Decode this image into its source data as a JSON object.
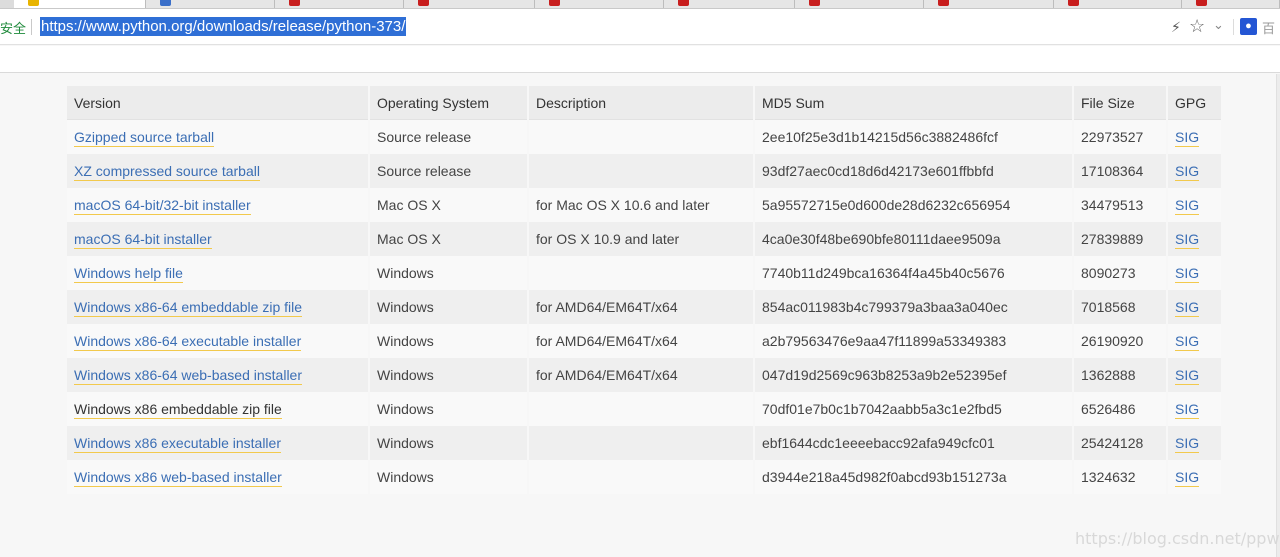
{
  "browser": {
    "security_label": "安全",
    "url": "https://www.python.org/downloads/release/python-373/",
    "extension_label": "百",
    "colors": {
      "selection": "#2f6fd6",
      "secure": "#1f8a3b",
      "tab_favicon": "#c81e1e"
    }
  },
  "table": {
    "headers": {
      "version": "Version",
      "os": "Operating System",
      "description": "Description",
      "md5": "MD5 Sum",
      "size": "File Size",
      "gpg": "GPG"
    },
    "rows": [
      {
        "version": "Gzipped source tarball",
        "os": "Source release",
        "description": "",
        "md5": "2ee10f25e3d1b14215d56c3882486fcf",
        "size": "22973527",
        "gpg": "SIG"
      },
      {
        "version": "XZ compressed source tarball",
        "os": "Source release",
        "description": "",
        "md5": "93df27aec0cd18d6d42173e601ffbbfd",
        "size": "17108364",
        "gpg": "SIG"
      },
      {
        "version": "macOS 64-bit/32-bit installer",
        "os": "Mac OS X",
        "description": "for Mac OS X 10.6 and later",
        "md5": "5a95572715e0d600de28d6232c656954",
        "size": "34479513",
        "gpg": "SIG"
      },
      {
        "version": "macOS 64-bit installer",
        "os": "Mac OS X",
        "description": "for OS X 10.9 and later",
        "md5": "4ca0e30f48be690bfe80111daee9509a",
        "size": "27839889",
        "gpg": "SIG"
      },
      {
        "version": "Windows help file",
        "os": "Windows",
        "description": "",
        "md5": "7740b11d249bca16364f4a45b40c5676",
        "size": "8090273",
        "gpg": "SIG"
      },
      {
        "version": "Windows x86-64 embeddable zip file",
        "os": "Windows",
        "description": "for AMD64/EM64T/x64",
        "md5": "854ac011983b4c799379a3baa3a040ec",
        "size": "7018568",
        "gpg": "SIG"
      },
      {
        "version": "Windows x86-64 executable installer",
        "os": "Windows",
        "description": "for AMD64/EM64T/x64",
        "md5": "a2b79563476e9aa47f11899a53349383",
        "size": "26190920",
        "gpg": "SIG"
      },
      {
        "version": "Windows x86-64 web-based installer",
        "os": "Windows",
        "description": "for AMD64/EM64T/x64",
        "md5": "047d19d2569c963b8253a9b2e52395ef",
        "size": "1362888",
        "gpg": "SIG"
      },
      {
        "version": "Windows x86 embeddable zip file",
        "os": "Windows",
        "description": "",
        "md5": "70df01e7b0c1b7042aabb5a3c1e2fbd5",
        "size": "6526486",
        "gpg": "SIG"
      },
      {
        "version": "Windows x86 executable installer",
        "os": "Windows",
        "description": "",
        "md5": "ebf1644cdc1eeeebacc92afa949cfc01",
        "size": "25424128",
        "gpg": "SIG"
      },
      {
        "version": "Windows x86 web-based installer",
        "os": "Windows",
        "description": "",
        "md5": "d3944e218a45d982f0abcd93b151273a",
        "size": "1324632",
        "gpg": "SIG"
      }
    ]
  },
  "watermark": "https://blog.csdn.net/ppwwp"
}
